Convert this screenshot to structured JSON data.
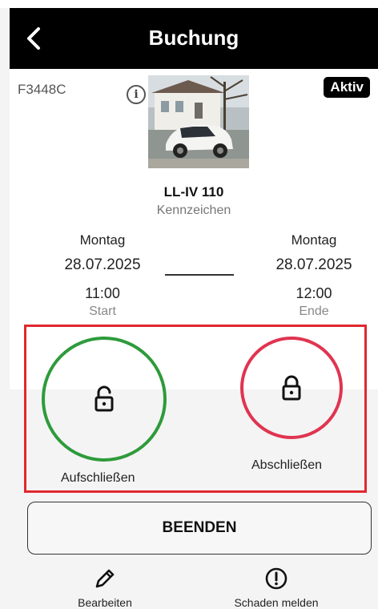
{
  "header": {
    "title": "Buchung"
  },
  "vehicle": {
    "code": "F3448C",
    "status_badge": "Aktiv",
    "plate": "LL-IV 110",
    "plate_label": "Kennzeichen"
  },
  "booking": {
    "start": {
      "day": "Montag",
      "date": "28.07.2025",
      "time": "11:00",
      "label": "Start"
    },
    "end": {
      "day": "Montag",
      "date": "28.07.2025",
      "time": "12:00",
      "label": "Ende"
    }
  },
  "locks": {
    "unlock_label": "Aufschließen",
    "lock_label": "Abschließen"
  },
  "actions": {
    "end_label": "BEENDEN",
    "edit_label": "Bearbeiten",
    "damage_label": "Schaden melden"
  },
  "colors": {
    "unlock": "#2e9b3b",
    "lock": "#e03450",
    "highlight": "#e0282e"
  }
}
